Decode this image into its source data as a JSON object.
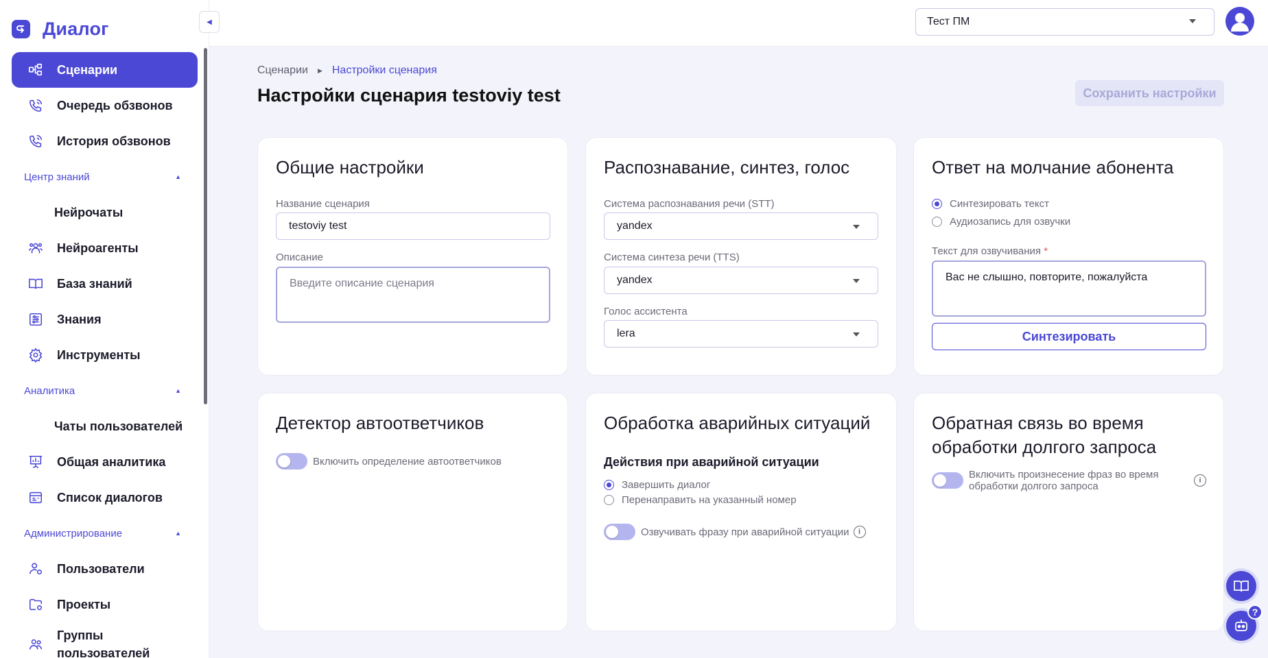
{
  "app": {
    "logo_text": "Диалог"
  },
  "sidebar": {
    "items": [
      {
        "label": "Сценарии",
        "icon": "scenarios-icon",
        "active": true
      },
      {
        "label": "Очередь обзвонов",
        "icon": "phone-queue-icon"
      },
      {
        "label": "История обзвонов",
        "icon": "phone-history-icon"
      }
    ],
    "sections": {
      "knowledge": {
        "title": "Центр знаний",
        "items": [
          {
            "label": "Нейрочаты"
          },
          {
            "label": "Нейроагенты",
            "icon": "agents-icon"
          },
          {
            "label": "База знаний",
            "icon": "book-icon"
          },
          {
            "label": "Знания",
            "icon": "sliders-icon"
          },
          {
            "label": "Инструменты",
            "icon": "gear-icon"
          }
        ]
      },
      "analytics": {
        "title": "Аналитика",
        "items": [
          {
            "label": "Чаты пользователей"
          },
          {
            "label": "Общая аналитика",
            "icon": "presentation-chart-icon"
          },
          {
            "label": "Список диалогов",
            "icon": "dialog-list-icon"
          }
        ]
      },
      "admin": {
        "title": "Администрирование",
        "items": [
          {
            "label": "Пользователи",
            "icon": "users-gear-icon"
          },
          {
            "label": "Проекты",
            "icon": "folder-gear-icon"
          },
          {
            "label": "Группы пользователей",
            "icon": "user-group-icon"
          }
        ]
      }
    }
  },
  "topbar": {
    "project": "Тест ПМ"
  },
  "breadcrumb": {
    "root": "Сценарии",
    "current": "Настройки сценария"
  },
  "page": {
    "title": "Настройки сценария testoviy test",
    "save_label": "Сохранить настройки"
  },
  "cards": {
    "general": {
      "title": "Общие настройки",
      "name_label": "Название сценария",
      "name_value": "testoviy test",
      "description_label": "Описание",
      "description_placeholder": "Введите описание сценария"
    },
    "speech": {
      "title": "Распознавание, синтез, голос",
      "stt_label": "Система распознавания речи (STT)",
      "stt_value": "yandex",
      "tts_label": "Система синтеза речи (TTS)",
      "tts_value": "yandex",
      "voice_label": "Голос ассистента",
      "voice_value": "lera"
    },
    "silence": {
      "title": "Ответ на молчание абонента",
      "option_synth": "Синтезировать текст",
      "option_audio": "Аудиозапись для озвучки",
      "selected": "Синтезировать текст",
      "text_label": "Текст для озвучивания",
      "required_mark": "*",
      "text_value": "Вас не слышно, повторите, пожалуйста",
      "synth_button": "Синтезировать"
    },
    "answering_machine": {
      "title": "Детектор автоответчиков",
      "toggle_label": "Включить определение автоответчиков",
      "enabled": false
    },
    "emergency": {
      "title": "Обработка аварийных ситуаций",
      "subtitle": "Действия при аварийной ситуации",
      "option_end": "Завершить диалог",
      "option_redirect": "Перенаправить на указанный номер",
      "selected": "Завершить диалог",
      "toggle_label": "Озвучивать фразу при аварийной ситуации",
      "enabled": false
    },
    "feedback": {
      "title_line1": "Обратная связь во время",
      "title_line2": "обработки долгого запроса",
      "toggle_line1": "Включить произнесение фраз во время",
      "toggle_line2": "обработки долгого запроса",
      "enabled": false
    }
  },
  "fab": {
    "help_badge": "?"
  },
  "colors": {
    "accent": "#4b48d6",
    "toggle_off": "#b4b5ee",
    "background": "#f3f4fb"
  }
}
